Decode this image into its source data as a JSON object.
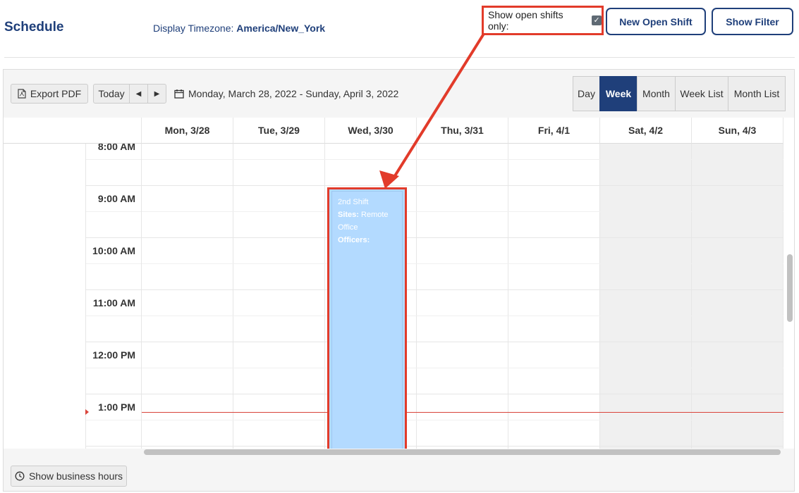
{
  "header": {
    "title": "Schedule",
    "timezone_label": "Display Timezone:",
    "timezone_value": "America/New_York",
    "open_shifts_label": "Show open shifts only:",
    "open_shifts_checked": true,
    "new_open_shift_label": "New Open Shift",
    "show_filter_label": "Show Filter"
  },
  "toolbar": {
    "export_pdf_label": "Export PDF",
    "today_label": "Today",
    "prev_label": "◀",
    "next_label": "▶",
    "date_range": "Monday, March 28, 2022 - Sunday, April 3, 2022",
    "views": [
      {
        "label": "Day",
        "active": false
      },
      {
        "label": "Week",
        "active": true
      },
      {
        "label": "Month",
        "active": false
      },
      {
        "label": "Week List",
        "active": false
      },
      {
        "label": "Month List",
        "active": false
      }
    ]
  },
  "calendar": {
    "days": [
      "Mon, 3/28",
      "Tue, 3/29",
      "Wed, 3/30",
      "Thu, 3/31",
      "Fri, 4/1",
      "Sat, 4/2",
      "Sun, 4/3"
    ],
    "weekend_days": [
      "Sat, 4/2",
      "Sun, 4/3"
    ],
    "times": [
      "8:00 AM",
      "9:00 AM",
      "10:00 AM",
      "11:00 AM",
      "12:00 PM",
      "1:00 PM"
    ],
    "event": {
      "title": "2nd Shift",
      "sites_label": "Sites:",
      "sites_value": "Remote Office",
      "officers_label": "Officers:",
      "day": "Wed, 3/30",
      "start": "9:00 AM"
    }
  },
  "footer": {
    "business_hours_label": "Show business hours"
  },
  "colors": {
    "brand": "#1f3f7a",
    "highlight": "#e23b2a",
    "event_bg": "#b3daff",
    "now_line": "#d9443a"
  }
}
